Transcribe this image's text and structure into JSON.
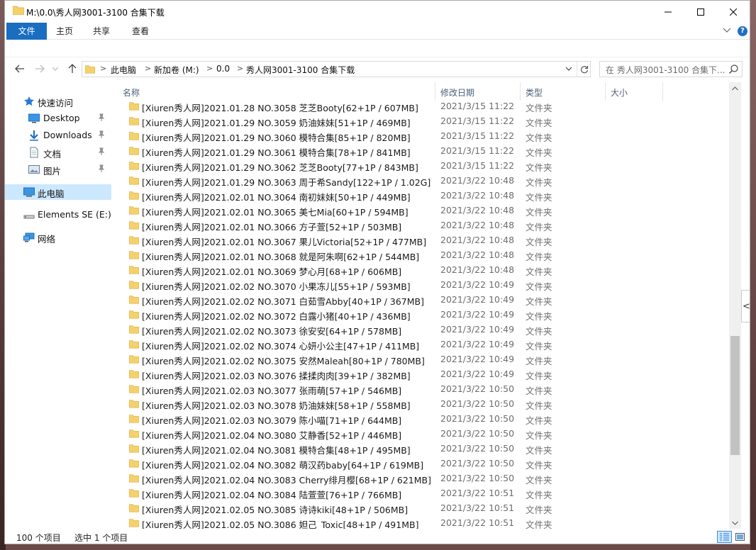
{
  "window": {
    "title": "M:\\0.0\\秀人网3001-3100 合集下载"
  },
  "ribbon": {
    "tabs": [
      "文件",
      "主页",
      "共享",
      "查看"
    ]
  },
  "address": {
    "crumbs": [
      "此电脑",
      "新加卷 (M:)",
      "0.0",
      "秀人网3001-3100 合集下载"
    ],
    "search_placeholder": "在 秀人网3001-3100 合集下..."
  },
  "sidebar": {
    "quick_access": "快速访问",
    "items": [
      "Desktop",
      "Downloads",
      "文档",
      "图片"
    ],
    "this_pc": "此电脑",
    "drive": "Elements SE (E:)",
    "network": "网络"
  },
  "columns": [
    "名称",
    "修改日期",
    "类型",
    "大小"
  ],
  "files": [
    {
      "name": "[Xiuren秀人网]2021.01.28 NO.3058 芝芝Booty[62+1P / 607MB]",
      "date": "2021/3/15 11:22",
      "type": "文件夹"
    },
    {
      "name": "[Xiuren秀人网]2021.01.29 NO.3059 奶油妹妹[51+1P / 469MB]",
      "date": "2021/3/15 11:22",
      "type": "文件夹"
    },
    {
      "name": "[Xiuren秀人网]2021.01.29 NO.3060 模特合集[85+1P / 820MB]",
      "date": "2021/3/15 11:22",
      "type": "文件夹"
    },
    {
      "name": "[Xiuren秀人网]2021.01.29 NO.3061 模特合集[78+1P / 841MB]",
      "date": "2021/3/15 11:22",
      "type": "文件夹"
    },
    {
      "name": "[Xiuren秀人网]2021.01.29 NO.3062 芝芝Booty[77+1P / 843MB]",
      "date": "2021/3/15 11:22",
      "type": "文件夹"
    },
    {
      "name": "[Xiuren秀人网]2021.01.29 NO.3063 周于希Sandy[122+1P / 1.02G]",
      "date": "2021/3/22 10:48",
      "type": "文件夹"
    },
    {
      "name": "[Xiuren秀人网]2021.02.01 NO.3064 南初妹妹[50+1P / 449MB]",
      "date": "2021/3/22 10:48",
      "type": "文件夹"
    },
    {
      "name": "[Xiuren秀人网]2021.02.01 NO.3065 美七Mia[60+1P / 594MB]",
      "date": "2021/3/22 10:48",
      "type": "文件夹"
    },
    {
      "name": "[Xiuren秀人网]2021.02.01 NO.3066 方子萱[52+1P / 503MB]",
      "date": "2021/3/22 10:48",
      "type": "文件夹"
    },
    {
      "name": "[Xiuren秀人网]2021.02.01 NO.3067 果儿Victoria[52+1P / 477MB]",
      "date": "2021/3/22 10:48",
      "type": "文件夹"
    },
    {
      "name": "[Xiuren秀人网]2021.02.01 NO.3068 就是阿朱啊[62+1P / 544MB]",
      "date": "2021/3/22 10:48",
      "type": "文件夹"
    },
    {
      "name": "[Xiuren秀人网]2021.02.01 NO.3069 梦心月[68+1P / 606MB]",
      "date": "2021/3/22 10:48",
      "type": "文件夹"
    },
    {
      "name": "[Xiuren秀人网]2021.02.02 NO.3070 小果冻儿[55+1P / 593MB]",
      "date": "2021/3/22 10:49",
      "type": "文件夹"
    },
    {
      "name": "[Xiuren秀人网]2021.02.02 NO.3071 白茹雪Abby[40+1P / 367MB]",
      "date": "2021/3/22 10:49",
      "type": "文件夹"
    },
    {
      "name": "[Xiuren秀人网]2021.02.02 NO.3072 白露小猪[40+1P / 436MB]",
      "date": "2021/3/22 10:49",
      "type": "文件夹"
    },
    {
      "name": "[Xiuren秀人网]2021.02.02 NO.3073 徐安安[64+1P / 578MB]",
      "date": "2021/3/22 10:49",
      "type": "文件夹"
    },
    {
      "name": "[Xiuren秀人网]2021.02.02 NO.3074 心妍小公主[47+1P / 411MB]",
      "date": "2021/3/22 10:49",
      "type": "文件夹"
    },
    {
      "name": "[Xiuren秀人网]2021.02.02 NO.3075 安然Maleah[80+1P / 780MB]",
      "date": "2021/3/22 10:49",
      "type": "文件夹"
    },
    {
      "name": "[Xiuren秀人网]2021.02.03 NO.3076 揉揉肉肉[39+1P / 382MB]",
      "date": "2021/3/22 10:49",
      "type": "文件夹"
    },
    {
      "name": "[Xiuren秀人网]2021.02.03 NO.3077 张雨萌[57+1P / 546MB]",
      "date": "2021/3/22 10:50",
      "type": "文件夹"
    },
    {
      "name": "[Xiuren秀人网]2021.02.03 NO.3078 奶油妹妹[58+1P / 558MB]",
      "date": "2021/3/22 10:50",
      "type": "文件夹"
    },
    {
      "name": "[Xiuren秀人网]2021.02.03 NO.3079 陈小喵[71+1P / 644MB]",
      "date": "2021/3/22 10:50",
      "type": "文件夹"
    },
    {
      "name": "[Xiuren秀人网]2021.02.04 NO.3080 艾静香[52+1P / 446MB]",
      "date": "2021/3/22 10:50",
      "type": "文件夹"
    },
    {
      "name": "[Xiuren秀人网]2021.02.04 NO.3081 模特合集[48+1P / 495MB]",
      "date": "2021/3/22 10:50",
      "type": "文件夹"
    },
    {
      "name": "[Xiuren秀人网]2021.02.04 NO.3082 萌汉药baby[64+1P / 619MB]",
      "date": "2021/3/22 10:50",
      "type": "文件夹"
    },
    {
      "name": "[Xiuren秀人网]2021.02.04 NO.3083 Cherry绯月樱[68+1P / 621MB]",
      "date": "2021/3/22 10:50",
      "type": "文件夹"
    },
    {
      "name": "[Xiuren秀人网]2021.02.04 NO.3084 陆萱萱[76+1P / 766MB]",
      "date": "2021/3/22 10:51",
      "type": "文件夹"
    },
    {
      "name": "[Xiuren秀人网]2021.02.05 NO.3085 诗诗kiki[48+1P / 506MB]",
      "date": "2021/3/22 10:51",
      "type": "文件夹"
    },
    {
      "name": "[Xiuren秀人网]2021.02.05 NO.3086 妲己_Toxic[48+1P / 491MB]",
      "date": "2021/3/22 10:51",
      "type": "文件夹"
    }
  ],
  "status": {
    "count": "100 个项目",
    "selected": "选中 1 个项目"
  },
  "colors": {
    "accent": "#1a6ec0",
    "folder": "#f6d16b",
    "selection": "#cce8ff",
    "header_text": "#4c607a"
  },
  "icons": [
    "folder-icon",
    "minimize-icon",
    "maximize-icon",
    "close-icon",
    "chevron-down-icon",
    "help-icon",
    "back-arrow-icon",
    "forward-arrow-icon",
    "up-arrow-icon",
    "refresh-icon",
    "search-icon",
    "star-icon",
    "desktop-icon",
    "download-icon",
    "document-icon",
    "picture-icon",
    "pin-icon",
    "computer-icon",
    "drive-icon",
    "network-icon",
    "details-view-icon",
    "tiles-view-icon"
  ]
}
